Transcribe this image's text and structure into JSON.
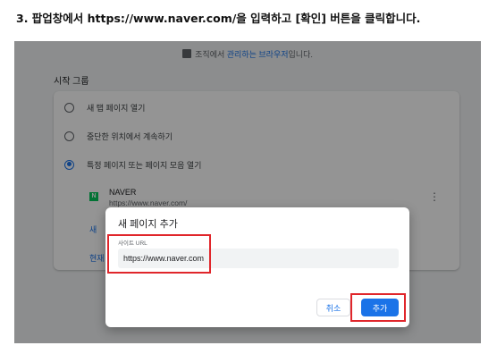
{
  "instruction": "3. 팝업창에서 https://www.naver.com/을 입력하고 [확인] 버튼을 클릭합니다.",
  "banner": {
    "text_before": "조직에서 ",
    "link": "관리하는 브라우저",
    "text_after": "입니다."
  },
  "section_title": "시작 그룹",
  "options": [
    {
      "label": "새 탭 페이지 열기",
      "checked": false
    },
    {
      "label": "중단한 위치에서 계속하기",
      "checked": false
    },
    {
      "label": "특정 페이지 또는 페이지 모음 열기",
      "checked": true
    }
  ],
  "page_entry": {
    "favicon": "N",
    "name": "NAVER",
    "url": "https://www.naver.com/"
  },
  "partial_links": {
    "add_page": "새 ",
    "use_current": "현재"
  },
  "dialog": {
    "title": "새 페이지 추가",
    "field_label": "사이트 URL",
    "field_value": "https://www.naver.com",
    "cancel_label": "취소",
    "add_label": "추가"
  },
  "colors": {
    "accent": "#1a73e8",
    "highlight": "#e0262b",
    "naver_green": "#03c75a"
  }
}
